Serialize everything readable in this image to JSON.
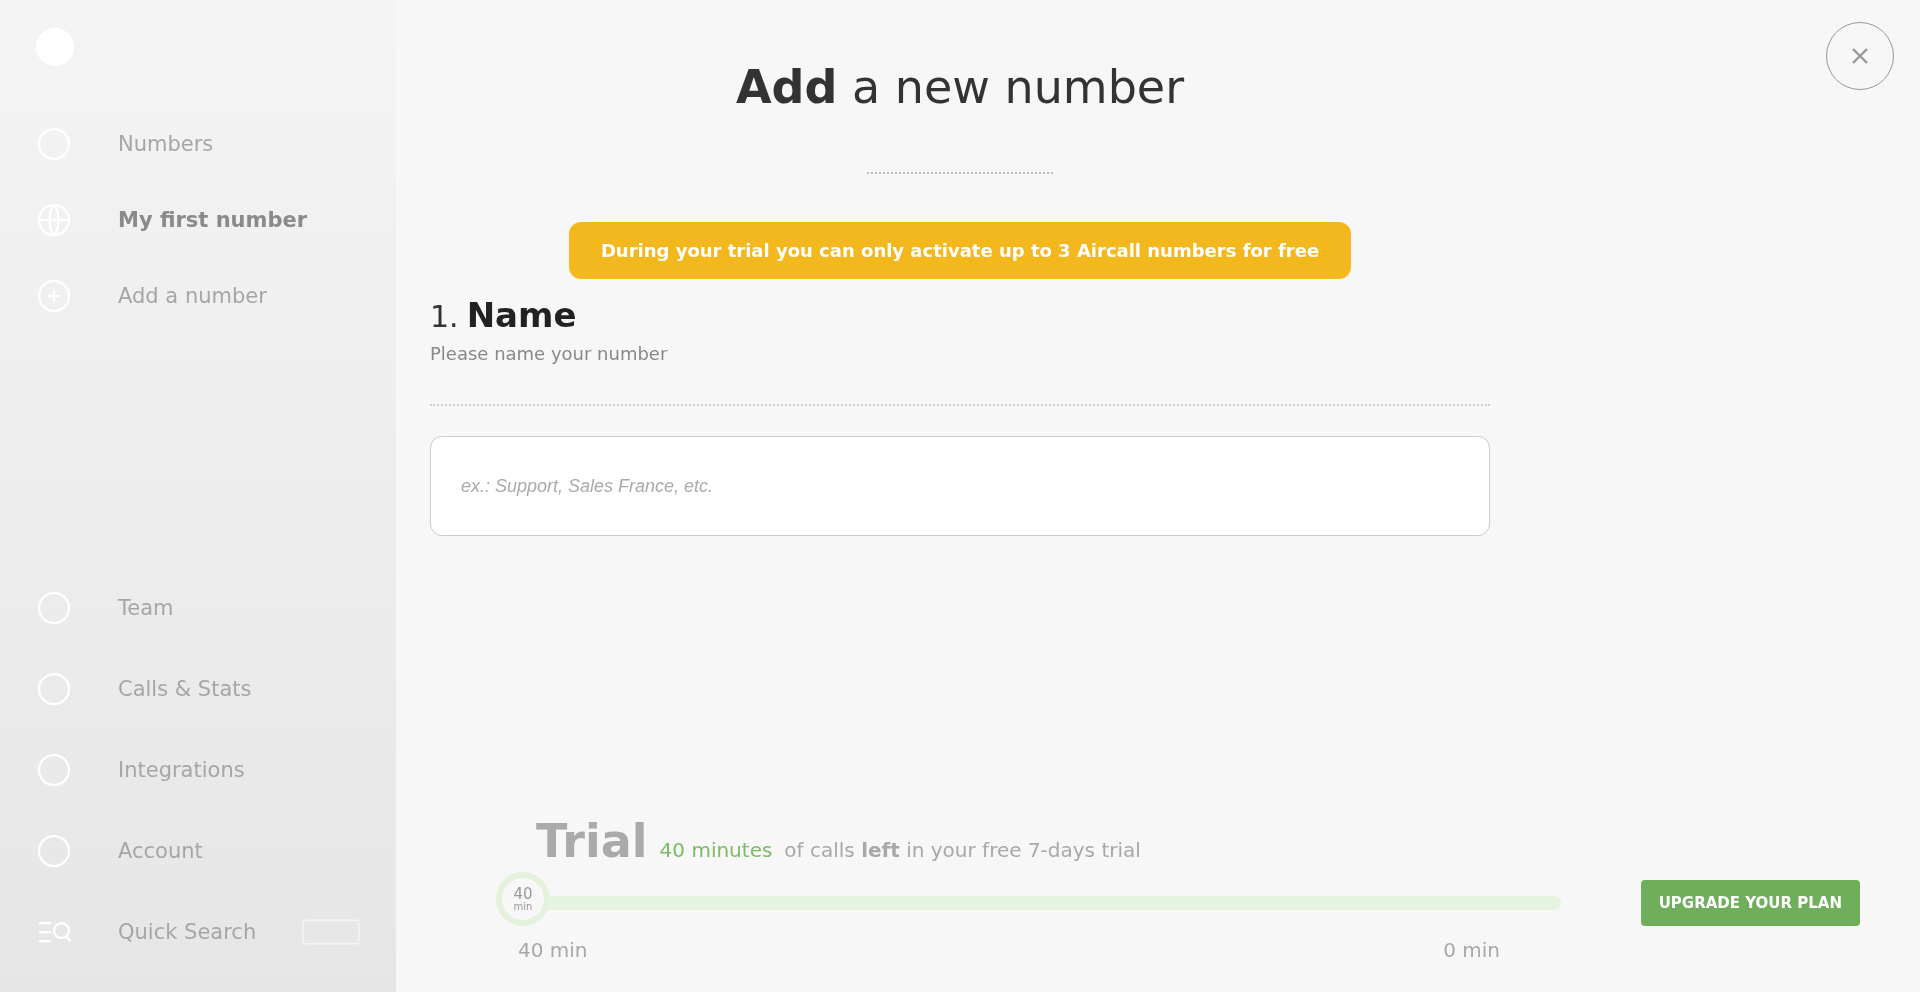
{
  "sidebar": {
    "header": {
      "label": "Numbers"
    },
    "numbers": [
      {
        "label": "My first number",
        "selected": true,
        "kind": "globe"
      },
      {
        "label": "Add a number",
        "selected": false,
        "kind": "add"
      }
    ],
    "items": [
      {
        "label": "Team",
        "kind": "team"
      },
      {
        "label": "Calls & Stats",
        "kind": "stats"
      },
      {
        "label": "Integrations",
        "kind": "integrations"
      },
      {
        "label": "Account",
        "kind": "account"
      },
      {
        "label": "Quick Search",
        "kind": "search"
      }
    ]
  },
  "trial": {
    "title": "Trial",
    "highlight": "40 minutes",
    "message": "of calls **left** in your free 7-days trial",
    "thumb_value": "40",
    "thumb_unit": "min",
    "level": 1,
    "start_label": "40 min",
    "end_label": "0 min",
    "upgrade_button": "UPGRADE YOUR PLAN"
  },
  "modal": {
    "title": "**Add** a new number",
    "notice": "During your trial you can only activate up to 3 Aircall numbers for free",
    "step_number": "1.",
    "step_title": "Name",
    "step_hint": "Please name your number",
    "name_field": {
      "placeholder": "ex.: Support, Sales France, etc."
    }
  }
}
